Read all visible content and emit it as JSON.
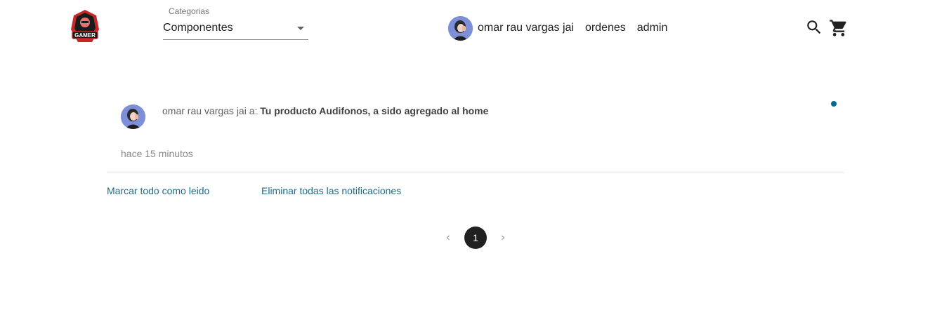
{
  "header": {
    "logo_text": "GAMER",
    "category": {
      "label": "Categorias",
      "value": "Componentes"
    },
    "user_name": "omar rau vargas jai",
    "nav": {
      "orders": "ordenes",
      "admin": "admin"
    },
    "icons": {
      "search": "search-icon",
      "cart": "cart-icon"
    }
  },
  "notifications": [
    {
      "sender": "omar rau vargas jai a:",
      "message": "Tu producto Audifonos, a sido agregado al home",
      "time": "hace 15 minutos",
      "unread": true
    }
  ],
  "actions": {
    "mark_all_read": "Marcar todo como leido",
    "delete_all": "Eliminar todas las notificaciones"
  },
  "pagination": {
    "current": "1"
  },
  "colors": {
    "accent_link": "#1f6b84",
    "unread_dot": "#006e8a",
    "active_page": "#212121"
  }
}
